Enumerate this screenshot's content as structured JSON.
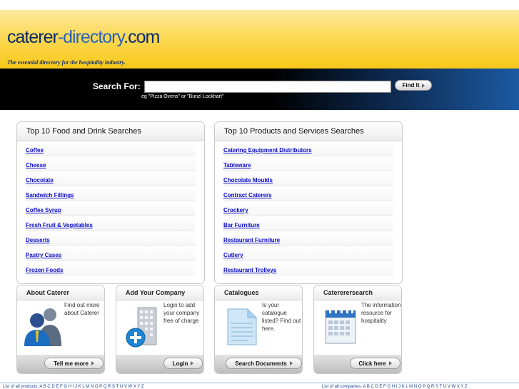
{
  "header": {
    "logo_part1": "caterer",
    "logo_part2": "-directory",
    "logo_part3": ".com",
    "tagline": "The essential directory for the hospitality industry."
  },
  "search": {
    "label": "Search For:",
    "value": "",
    "hint": "eg \"Pizza Ovens\" or \"Bunzl Lockhart\"",
    "button": "Find It"
  },
  "food_panel": {
    "title": "Top 10 Food and Drink Searches",
    "items": [
      "Coffee",
      "Cheese",
      "Chocolate",
      "Sandwich Fillings",
      "Coffee Syrup",
      "Fresh Fruit & Vegetables",
      "Desserts",
      "Pastry Cases",
      "Frozen Foods"
    ]
  },
  "products_panel": {
    "title": "Top 10 Products and Services Searches",
    "items": [
      "Catering Equipment Distributors",
      "Tableware",
      "Chocolate Moulds",
      "Contract Caterers",
      "Crockery",
      "Bar Furniture",
      "Restaurant Furniture",
      "Cutlery",
      "Restaurant Trolleys"
    ]
  },
  "boxes": [
    {
      "title": "About Caterer",
      "text": "Find out more about Caterer",
      "button": "Tell me more",
      "icon": "people-icon"
    },
    {
      "title": "Add Your Company",
      "text": "Login to add your company free of charge",
      "button": "Login",
      "icon": "building-add-icon"
    },
    {
      "title": "Catalogues",
      "text": "Is your catalogue listed? Find out here.",
      "button": "Search Documents",
      "icon": "document-icon"
    },
    {
      "title": "Catererersearch",
      "text": "The information resource for hospitality",
      "button": "Click here",
      "icon": "calendar-icon"
    }
  ],
  "footer": {
    "left": "List of all products: A B C D E F G H I J K L M N O P Q R S T U V W X Y Z",
    "right": "List of all companies: A B C D E F G H I J K L M N O P Q R S T U V W X Y Z"
  },
  "colors": {
    "header_yellow": "#f8c81a",
    "link_blue": "#0b0bcc",
    "logo_navy": "#0a2a6a"
  }
}
